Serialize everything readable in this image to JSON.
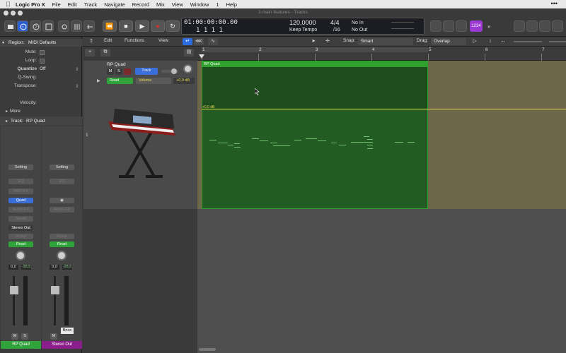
{
  "menubar": {
    "app": "Logic Pro X",
    "items": [
      "File",
      "Edit",
      "Track",
      "Navigate",
      "Record",
      "Mix",
      "View",
      "Window",
      "1",
      "Help"
    ]
  },
  "window": {
    "title": "3 main features - Tracks"
  },
  "lcd": {
    "time": "01:00:00:00.00",
    "bars": "1  1  1  1",
    "tempo": "120,0000",
    "tempo_mode": "Keep Tempo",
    "sig_top": "4/4",
    "sig_bottom": "/16",
    "midi_in": "No In",
    "midi_out": "No Out"
  },
  "purple_badge": "1234",
  "inspector": {
    "region_label": "Region:",
    "region_value": "MIDI Defaults",
    "mute": "Mute:",
    "loop": "Loop:",
    "quantize": "Quantize",
    "quantize_value": "Off",
    "qswing": "Q-Swing:",
    "transpose": "Transpose:",
    "velocity": "Velocity:",
    "more": "More",
    "track_label": "Track:",
    "track_value": "RP Quad"
  },
  "strip_left": {
    "setting": "Setting",
    "eq": "EQ",
    "midi_fx": "MIDI FX",
    "instrument": "Quad",
    "audio_fx": "Audio FX",
    "sends": "Sends",
    "output": "Stereo Out",
    "group": "Group",
    "automation": "Read",
    "pan_value": "0,0",
    "level_value": "-28,5",
    "m": "M",
    "s": "S",
    "name": "RP Quad"
  },
  "strip_right": {
    "setting": "Setting",
    "eq": "EQ",
    "audio_fx": "Audio FX",
    "group": "Group",
    "automation": "Read",
    "pan_value": "0,0",
    "level_value": "-28,5",
    "m": "M",
    "tooltip": "Bnce",
    "name": "Stereo Out"
  },
  "tracks_toolbar": {
    "edit": "Edit",
    "functions": "Functions",
    "view": "View",
    "snap_label": "Snap:",
    "snap_value": "Smart",
    "drag_label": "Drag:",
    "drag_value": "Overlap"
  },
  "track": {
    "number": "1",
    "name": "RP Quad",
    "m": "M",
    "s": "S",
    "track_btn": "Track",
    "automation_mode": "Read",
    "automation_param": "Volume",
    "automation_value": "+0,0 dB"
  },
  "ruler": [
    "1",
    "2",
    "3",
    "4",
    "5",
    "6",
    "7"
  ],
  "region": {
    "name": "RP Quad",
    "volume_label": "+0,0 dB"
  }
}
